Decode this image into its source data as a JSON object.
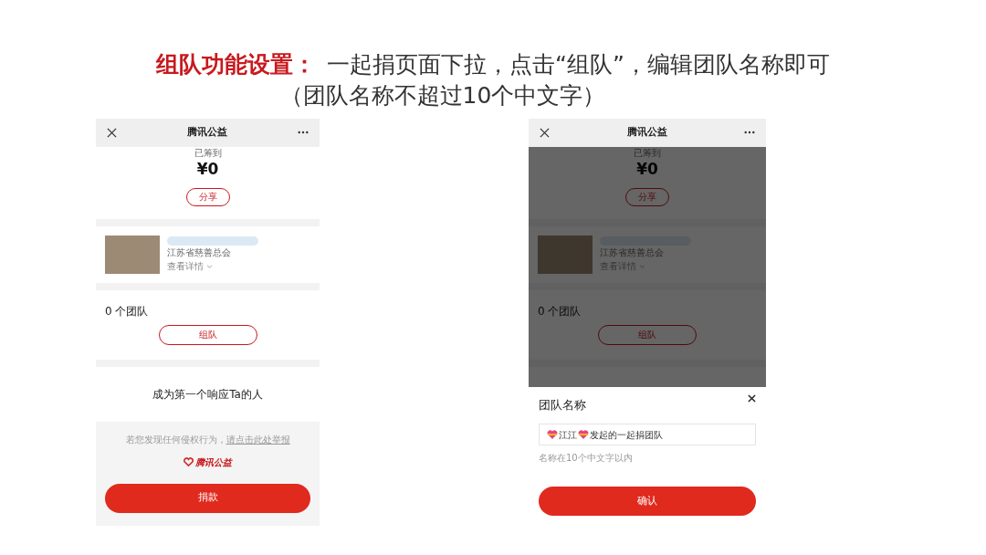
{
  "slide": {
    "heading": "组队功能设置：",
    "instruction": "一起捐页面下拉，点击“组队”，编辑团队名称即可",
    "note": "（团队名称不超过10个中文字）"
  },
  "phones": [
    {
      "header": {
        "title": "腾讯公益"
      },
      "raised_label": "已筹到",
      "raised_amount": "¥0",
      "share_button": "分享",
      "project": {
        "organization": "江苏省慈善总会",
        "details_link": "查看详情"
      },
      "team_count": "0 个团队",
      "team_button": "组队",
      "first_responder": "成为第一个响应Ta的人",
      "report_text": "若您发现任何侵权行为，",
      "report_link": "请点击此处举报",
      "footer_logo": "腾讯公益",
      "donate_button": "捐款",
      "dimmed": false
    },
    {
      "header": {
        "title": "腾讯公益"
      },
      "raised_label": "已筹到",
      "raised_amount": "¥0",
      "share_button": "分享",
      "project": {
        "organization": "江苏省慈善总会",
        "details_link": "查看详情"
      },
      "team_count": "0 个团队",
      "team_button": "组队",
      "dimmed": true,
      "sheet": {
        "title": "团队名称",
        "name_field": [
          {
            "kind": "heart"
          },
          {
            "kind": "text",
            "text": "江江"
          },
          {
            "kind": "heart"
          },
          {
            "kind": "text",
            "text": "发起的一起捐团队"
          }
        ],
        "hint": "名称在10个中文字以内",
        "confirm_button": "确认"
      }
    }
  ]
}
